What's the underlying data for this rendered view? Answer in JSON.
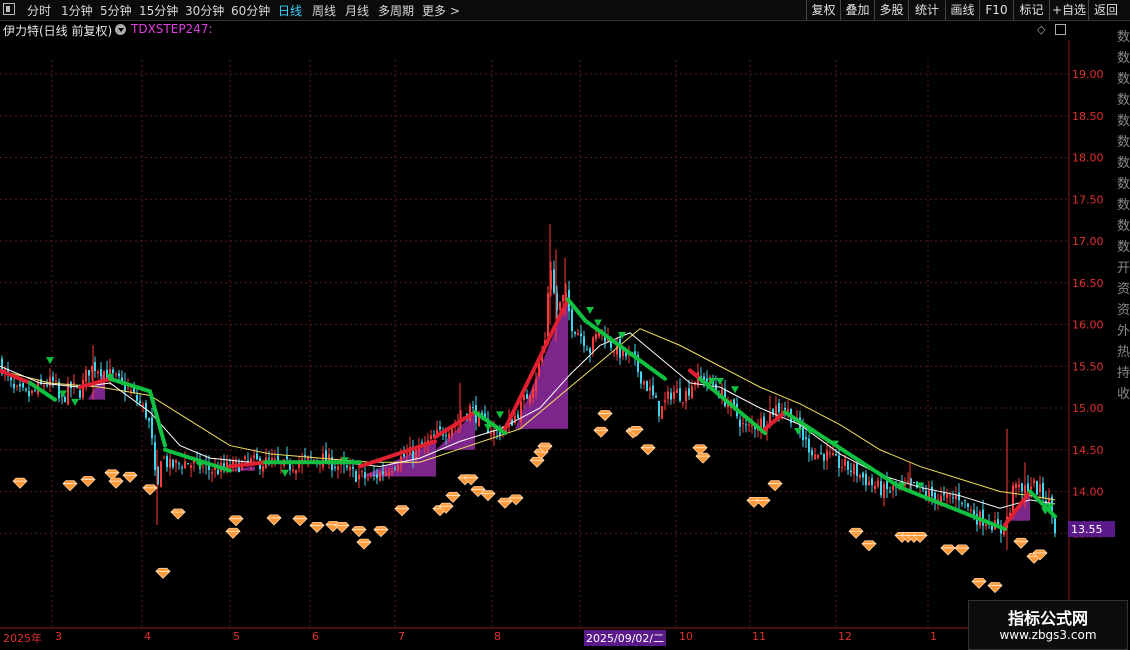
{
  "toolbar": {
    "periods": [
      "分时",
      "1分钟",
      "5分钟",
      "15分钟",
      "30分钟",
      "60分钟",
      "日线",
      "周线",
      "月线",
      "多周期",
      "更多 >"
    ],
    "active_period": "日线",
    "right_buttons": [
      "复权",
      "叠加",
      "多股",
      "统计",
      "画线",
      "F10",
      "标记",
      "+自选",
      "返回"
    ]
  },
  "header": {
    "stock_title": "伊力特(日线 前复权)",
    "indicator_name": "TDXSTEP247:"
  },
  "sidebar_chars": "数数数数数数数数数数数开资资外热持收",
  "watermark": {
    "name": "指标公式网",
    "url": "www.zbgs3.com"
  },
  "colors": {
    "up": "#ff3b3b",
    "down": "#3fd6f0",
    "ma_short": "#ffffff",
    "ma_long": "#f0e060",
    "step_up": "#e02030",
    "step_down": "#10c040",
    "fill": "#8a2a9a",
    "grid": "#5a1a1a",
    "axis_text": "#e03030",
    "price_tag": "#5a1a8a",
    "diamond": "#ff9a3a"
  },
  "chart_data": {
    "type": "line",
    "title": "伊力特(日线 前复权)",
    "ylim": [
      12.6,
      19.5
    ],
    "y_ticks": [
      "19.00",
      "18.50",
      "18.00",
      "17.50",
      "17.00",
      "16.50",
      "16.00",
      "15.50",
      "15.00",
      "14.50",
      "14.00",
      "13.50"
    ],
    "x_labels": [
      "2025年",
      "3",
      "4",
      "5",
      "6",
      "7",
      "8",
      "2025/09/02/二",
      "10",
      "11",
      "12",
      "1"
    ],
    "highlight_x_label": "2025/09/02/二",
    "current_price_label": "13.55",
    "current_price": 13.55,
    "close_anchors": [
      [
        0,
        15.55
      ],
      [
        14,
        15.2
      ],
      [
        30,
        15.15
      ],
      [
        45,
        15.3
      ],
      [
        55,
        15.3
      ],
      [
        60,
        15.05
      ],
      [
        70,
        15.25
      ],
      [
        80,
        15.2
      ],
      [
        88,
        15.45
      ],
      [
        95,
        15.5
      ],
      [
        110,
        15.4
      ],
      [
        120,
        15.3
      ],
      [
        130,
        15.2
      ],
      [
        140,
        15.05
      ],
      [
        148,
        14.9
      ],
      [
        153,
        14.5
      ],
      [
        157,
        13.85
      ],
      [
        160,
        14.45
      ],
      [
        170,
        14.3
      ],
      [
        185,
        14.35
      ],
      [
        200,
        14.3
      ],
      [
        215,
        14.25
      ],
      [
        230,
        14.3
      ],
      [
        250,
        14.35
      ],
      [
        270,
        14.35
      ],
      [
        285,
        14.3
      ],
      [
        300,
        14.35
      ],
      [
        320,
        14.4
      ],
      [
        340,
        14.3
      ],
      [
        355,
        14.2
      ],
      [
        370,
        14.15
      ],
      [
        385,
        14.25
      ],
      [
        400,
        14.4
      ],
      [
        420,
        14.5
      ],
      [
        440,
        14.7
      ],
      [
        460,
        14.85
      ],
      [
        470,
        15.0
      ],
      [
        480,
        14.85
      ],
      [
        495,
        14.7
      ],
      [
        505,
        14.75
      ],
      [
        515,
        14.9
      ],
      [
        525,
        15.1
      ],
      [
        535,
        15.35
      ],
      [
        545,
        15.8
      ],
      [
        550,
        16.8
      ],
      [
        556,
        16.15
      ],
      [
        565,
        16.35
      ],
      [
        572,
        16.0
      ],
      [
        580,
        15.9
      ],
      [
        590,
        15.7
      ],
      [
        600,
        15.95
      ],
      [
        612,
        15.75
      ],
      [
        622,
        15.65
      ],
      [
        632,
        15.6
      ],
      [
        640,
        15.4
      ],
      [
        650,
        15.2
      ],
      [
        660,
        14.95
      ],
      [
        672,
        15.2
      ],
      [
        685,
        15.15
      ],
      [
        695,
        15.35
      ],
      [
        705,
        15.35
      ],
      [
        715,
        15.25
      ],
      [
        725,
        15.1
      ],
      [
        735,
        14.95
      ],
      [
        745,
        14.75
      ],
      [
        755,
        14.8
      ],
      [
        765,
        14.85
      ],
      [
        775,
        15.0
      ],
      [
        785,
        15.0
      ],
      [
        795,
        14.85
      ],
      [
        805,
        14.6
      ],
      [
        815,
        14.45
      ],
      [
        825,
        14.45
      ],
      [
        835,
        14.35
      ],
      [
        845,
        14.3
      ],
      [
        855,
        14.25
      ],
      [
        870,
        14.1
      ],
      [
        885,
        14.0
      ],
      [
        900,
        14.05
      ],
      [
        915,
        14.05
      ],
      [
        930,
        13.95
      ],
      [
        945,
        13.9
      ],
      [
        960,
        13.95
      ],
      [
        975,
        13.7
      ],
      [
        990,
        13.65
      ],
      [
        1000,
        13.5
      ],
      [
        1010,
        13.75
      ],
      [
        1015,
        14.2
      ],
      [
        1020,
        13.95
      ],
      [
        1030,
        14.1
      ],
      [
        1040,
        14.0
      ],
      [
        1050,
        13.85
      ],
      [
        1055,
        13.55
      ]
    ],
    "ma_short_anchors": [
      [
        0,
        15.5
      ],
      [
        40,
        15.3
      ],
      [
        80,
        15.25
      ],
      [
        110,
        15.3
      ],
      [
        150,
        14.95
      ],
      [
        180,
        14.55
      ],
      [
        210,
        14.4
      ],
      [
        250,
        14.35
      ],
      [
        300,
        14.35
      ],
      [
        340,
        14.35
      ],
      [
        380,
        14.3
      ],
      [
        420,
        14.4
      ],
      [
        460,
        14.6
      ],
      [
        500,
        14.75
      ],
      [
        540,
        15.0
      ],
      [
        570,
        15.4
      ],
      [
        600,
        15.75
      ],
      [
        630,
        15.9
      ],
      [
        660,
        15.6
      ],
      [
        690,
        15.3
      ],
      [
        720,
        15.25
      ],
      [
        760,
        15.0
      ],
      [
        800,
        14.8
      ],
      [
        840,
        14.45
      ],
      [
        880,
        14.2
      ],
      [
        920,
        14.05
      ],
      [
        960,
        13.95
      ],
      [
        1000,
        13.8
      ],
      [
        1030,
        13.9
      ],
      [
        1055,
        13.85
      ]
    ],
    "ma_long_anchors": [
      [
        0,
        15.45
      ],
      [
        50,
        15.3
      ],
      [
        100,
        15.25
      ],
      [
        150,
        15.15
      ],
      [
        190,
        14.85
      ],
      [
        230,
        14.55
      ],
      [
        270,
        14.45
      ],
      [
        320,
        14.4
      ],
      [
        370,
        14.35
      ],
      [
        420,
        14.35
      ],
      [
        470,
        14.55
      ],
      [
        520,
        14.75
      ],
      [
        560,
        15.15
      ],
      [
        600,
        15.55
      ],
      [
        640,
        15.95
      ],
      [
        680,
        15.75
      ],
      [
        720,
        15.5
      ],
      [
        760,
        15.25
      ],
      [
        800,
        15.05
      ],
      [
        840,
        14.8
      ],
      [
        880,
        14.5
      ],
      [
        920,
        14.3
      ],
      [
        960,
        14.15
      ],
      [
        1000,
        14.0
      ],
      [
        1030,
        13.95
      ],
      [
        1055,
        13.9
      ]
    ],
    "step_segments": [
      {
        "trend": "up",
        "from": [
          0,
          15.45
        ],
        "to": [
          30,
          15.3
        ]
      },
      {
        "trend": "down",
        "from": [
          30,
          15.3
        ],
        "to": [
          55,
          15.1
        ]
      },
      {
        "trend": "up",
        "from": [
          80,
          15.25
        ],
        "to": [
          110,
          15.35
        ]
      },
      {
        "trend": "down",
        "from": [
          110,
          15.35
        ],
        "to": [
          150,
          15.2
        ]
      },
      {
        "trend": "down",
        "from": [
          150,
          15.2
        ],
        "to": [
          165,
          14.55
        ]
      },
      {
        "trend": "down",
        "from": [
          165,
          14.5
        ],
        "to": [
          230,
          14.25
        ]
      },
      {
        "trend": "up",
        "from": [
          230,
          14.3
        ],
        "to": [
          265,
          14.35
        ]
      },
      {
        "trend": "down",
        "from": [
          265,
          14.35
        ],
        "to": [
          360,
          14.35
        ]
      },
      {
        "trend": "up",
        "from": [
          360,
          14.3
        ],
        "to": [
          435,
          14.6
        ]
      },
      {
        "trend": "up",
        "from": [
          435,
          14.65
        ],
        "to": [
          475,
          14.95
        ]
      },
      {
        "trend": "down",
        "from": [
          475,
          14.95
        ],
        "to": [
          505,
          14.7
        ]
      },
      {
        "trend": "up",
        "from": [
          505,
          14.75
        ],
        "to": [
          568,
          16.3
        ]
      },
      {
        "trend": "down",
        "from": [
          568,
          16.3
        ],
        "to": [
          585,
          16.05
        ]
      },
      {
        "trend": "down",
        "from": [
          585,
          16.05
        ],
        "to": [
          665,
          15.35
        ]
      },
      {
        "trend": "up",
        "from": [
          690,
          15.45
        ],
        "to": [
          700,
          15.35
        ]
      },
      {
        "trend": "down",
        "from": [
          700,
          15.35
        ],
        "to": [
          765,
          14.7
        ]
      },
      {
        "trend": "up",
        "from": [
          765,
          14.75
        ],
        "to": [
          785,
          14.95
        ]
      },
      {
        "trend": "down",
        "from": [
          785,
          14.95
        ],
        "to": [
          900,
          14.05
        ]
      },
      {
        "trend": "down",
        "from": [
          900,
          14.05
        ],
        "to": [
          1005,
          13.55
        ]
      },
      {
        "trend": "up",
        "from": [
          1005,
          13.6
        ],
        "to": [
          1030,
          14.0
        ]
      },
      {
        "trend": "down",
        "from": [
          1030,
          14.0
        ],
        "to": [
          1055,
          13.7
        ]
      }
    ],
    "fill_regions": [
      {
        "x0": 88,
        "x1": 105,
        "top": 15.45,
        "bottom": 15.1
      },
      {
        "x0": 225,
        "x1": 255,
        "top": 14.3,
        "bottom": 14.25
      },
      {
        "x0": 362,
        "x1": 436,
        "top": 14.6,
        "bottom": 14.18
      },
      {
        "x0": 436,
        "x1": 475,
        "top": 14.95,
        "bottom": 14.5
      },
      {
        "x0": 515,
        "x1": 568,
        "top": 16.3,
        "bottom": 14.75
      },
      {
        "x0": 1005,
        "x1": 1030,
        "top": 14.0,
        "bottom": 13.65
      }
    ],
    "up_arrows": [
      [
        50,
        15.55
      ],
      [
        63,
        15.15
      ],
      [
        75,
        15.05
      ],
      [
        110,
        15.35
      ],
      [
        200,
        14.3
      ],
      [
        285,
        14.2
      ],
      [
        345,
        14.35
      ],
      [
        488,
        14.75
      ],
      [
        500,
        14.9
      ],
      [
        590,
        16.15
      ],
      [
        598,
        16.0
      ],
      [
        622,
        15.85
      ],
      [
        708,
        15.25
      ],
      [
        712,
        15.3
      ],
      [
        720,
        15.3
      ],
      [
        735,
        15.2
      ],
      [
        798,
        14.7
      ],
      [
        810,
        14.7
      ],
      [
        835,
        14.55
      ],
      [
        902,
        14.05
      ],
      [
        920,
        14.05
      ],
      [
        1045,
        13.75
      ],
      [
        1050,
        13.8
      ]
    ],
    "diamonds": [
      [
        20,
        14.1
      ],
      [
        70,
        14.07
      ],
      [
        88,
        14.12
      ],
      [
        112,
        14.2
      ],
      [
        116,
        14.1
      ],
      [
        130,
        14.17
      ],
      [
        150,
        14.02
      ],
      [
        163,
        13.02
      ],
      [
        178,
        13.73
      ],
      [
        233,
        13.5
      ],
      [
        236,
        13.65
      ],
      [
        274,
        13.66
      ],
      [
        300,
        13.65
      ],
      [
        317,
        13.57
      ],
      [
        333,
        13.58
      ],
      [
        342,
        13.57
      ],
      [
        359,
        13.52
      ],
      [
        364,
        13.37
      ],
      [
        381,
        13.52
      ],
      [
        402,
        13.77
      ],
      [
        440,
        13.77
      ],
      [
        446,
        13.8
      ],
      [
        453,
        13.93
      ],
      [
        465,
        14.14
      ],
      [
        471,
        14.14
      ],
      [
        478,
        14.0
      ],
      [
        488,
        13.95
      ],
      [
        505,
        13.86
      ],
      [
        516,
        13.9
      ],
      [
        537,
        14.35
      ],
      [
        541,
        14.45
      ],
      [
        545,
        14.52
      ],
      [
        601,
        14.71
      ],
      [
        605,
        14.91
      ],
      [
        633,
        14.7
      ],
      [
        636,
        14.72
      ],
      [
        648,
        14.5
      ],
      [
        700,
        14.5
      ],
      [
        703,
        14.4
      ],
      [
        754,
        13.87
      ],
      [
        763,
        13.87
      ],
      [
        775,
        14.07
      ],
      [
        856,
        13.5
      ],
      [
        869,
        13.35
      ],
      [
        902,
        13.45
      ],
      [
        908,
        13.45
      ],
      [
        914,
        13.45
      ],
      [
        920,
        13.45
      ],
      [
        948,
        13.3
      ],
      [
        962,
        13.3
      ],
      [
        979,
        12.9
      ],
      [
        995,
        12.85
      ],
      [
        1021,
        13.38
      ],
      [
        1034,
        13.2
      ],
      [
        1040,
        13.24
      ]
    ]
  }
}
